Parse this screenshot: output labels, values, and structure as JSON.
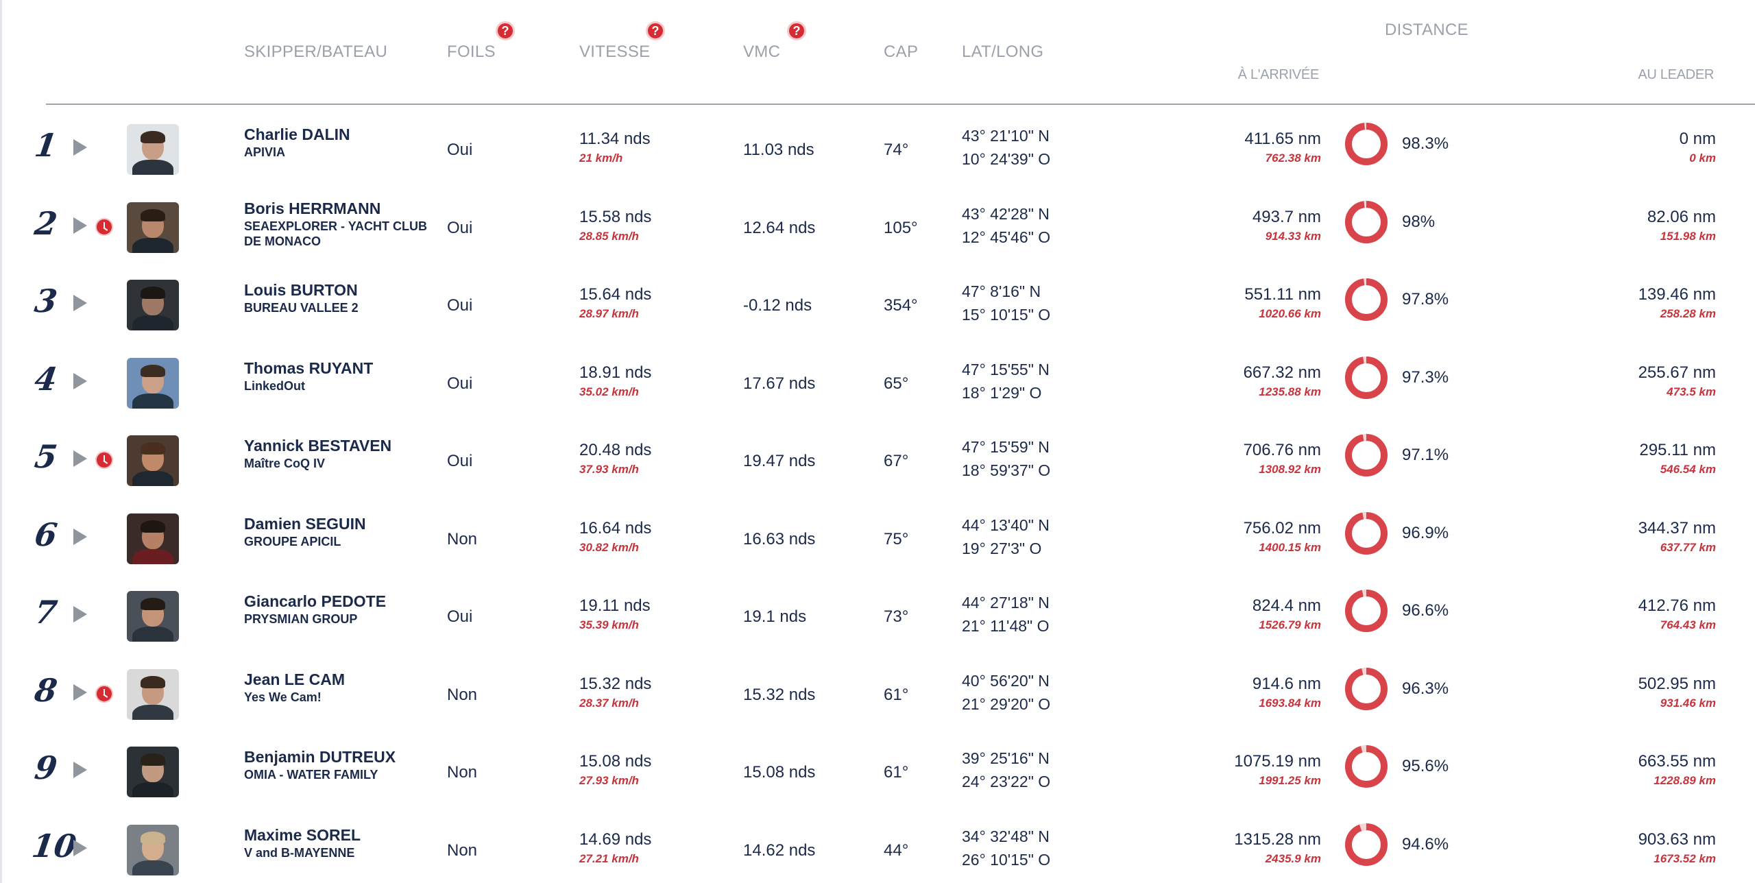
{
  "header": {
    "skipper": "SKIPPER/BATEAU",
    "foils": "FOILS",
    "vitesse": "VITESSE",
    "vmc": "VMC",
    "cap": "CAP",
    "latlong": "LAT/LONG",
    "distance": "DISTANCE",
    "a_arrivee": "À L'ARRIVÉE",
    "au_leader": "AU LEADER",
    "help_glyph": "?"
  },
  "colors": {
    "accent": "#d62b33",
    "text": "#1b2a4a",
    "muted": "#9aa1ab"
  },
  "rows": [
    {
      "rank": "1",
      "clock": false,
      "name": "Charlie DALIN",
      "boat": "APIVIA",
      "foils": "Oui",
      "speed": "11.34 nds",
      "speed_kmh": "21 km/h",
      "vmc": "11.03 nds",
      "cap": "74°",
      "lat": "43° 21'10\" N",
      "lon": "10° 24'39\" O",
      "dist": "411.65 nm",
      "dist_km": "762.38 km",
      "pct": "98.3%",
      "pct_value": 98.3,
      "lead": "0 nm",
      "lead_km": "0 km"
    },
    {
      "rank": "2",
      "clock": true,
      "name": "Boris HERRMANN",
      "boat": "SEAEXPLORER - YACHT CLUB DE MONACO",
      "foils": "Oui",
      "speed": "15.58 nds",
      "speed_kmh": "28.85 km/h",
      "vmc": "12.64 nds",
      "cap": "105°",
      "lat": "43° 42'28\" N",
      "lon": "12° 45'46\" O",
      "dist": "493.7 nm",
      "dist_km": "914.33 km",
      "pct": "98%",
      "pct_value": 98,
      "lead": "82.06 nm",
      "lead_km": "151.98 km"
    },
    {
      "rank": "3",
      "clock": false,
      "name": "Louis BURTON",
      "boat": "BUREAU VALLEE 2",
      "foils": "Oui",
      "speed": "15.64 nds",
      "speed_kmh": "28.97 km/h",
      "vmc": "-0.12 nds",
      "cap": "354°",
      "lat": "47° 8'16\" N",
      "lon": "15° 10'15\" O",
      "dist": "551.11 nm",
      "dist_km": "1020.66 km",
      "pct": "97.8%",
      "pct_value": 97.8,
      "lead": "139.46 nm",
      "lead_km": "258.28 km"
    },
    {
      "rank": "4",
      "clock": false,
      "name": "Thomas RUYANT",
      "boat": "LinkedOut",
      "foils": "Oui",
      "speed": "18.91 nds",
      "speed_kmh": "35.02 km/h",
      "vmc": "17.67 nds",
      "cap": "65°",
      "lat": "47° 15'55\" N",
      "lon": "18° 1'29\" O",
      "dist": "667.32 nm",
      "dist_km": "1235.88 km",
      "pct": "97.3%",
      "pct_value": 97.3,
      "lead": "255.67 nm",
      "lead_km": "473.5 km"
    },
    {
      "rank": "5",
      "clock": true,
      "name": "Yannick BESTAVEN",
      "boat": "Maître CoQ IV",
      "foils": "Oui",
      "speed": "20.48 nds",
      "speed_kmh": "37.93 km/h",
      "vmc": "19.47 nds",
      "cap": "67°",
      "lat": "47° 15'59\" N",
      "lon": "18° 59'37\" O",
      "dist": "706.76 nm",
      "dist_km": "1308.92 km",
      "pct": "97.1%",
      "pct_value": 97.1,
      "lead": "295.11 nm",
      "lead_km": "546.54 km"
    },
    {
      "rank": "6",
      "clock": false,
      "name": "Damien SEGUIN",
      "boat": "GROUPE APICIL",
      "foils": "Non",
      "speed": "16.64 nds",
      "speed_kmh": "30.82 km/h",
      "vmc": "16.63 nds",
      "cap": "75°",
      "lat": "44° 13'40\" N",
      "lon": "19° 27'3\" O",
      "dist": "756.02 nm",
      "dist_km": "1400.15 km",
      "pct": "96.9%",
      "pct_value": 96.9,
      "lead": "344.37 nm",
      "lead_km": "637.77 km"
    },
    {
      "rank": "7",
      "clock": false,
      "name": "Giancarlo PEDOTE",
      "boat": "PRYSMIAN GROUP",
      "foils": "Oui",
      "speed": "19.11 nds",
      "speed_kmh": "35.39 km/h",
      "vmc": "19.1 nds",
      "cap": "73°",
      "lat": "44° 27'18\" N",
      "lon": "21° 11'48\" O",
      "dist": "824.4 nm",
      "dist_km": "1526.79 km",
      "pct": "96.6%",
      "pct_value": 96.6,
      "lead": "412.76 nm",
      "lead_km": "764.43 km"
    },
    {
      "rank": "8",
      "clock": true,
      "name": "Jean LE CAM",
      "boat": "Yes We Cam!",
      "foils": "Non",
      "speed": "15.32 nds",
      "speed_kmh": "28.37 km/h",
      "vmc": "15.32 nds",
      "cap": "61°",
      "lat": "40° 56'20\" N",
      "lon": "21° 29'20\" O",
      "dist": "914.6 nm",
      "dist_km": "1693.84 km",
      "pct": "96.3%",
      "pct_value": 96.3,
      "lead": "502.95 nm",
      "lead_km": "931.46 km"
    },
    {
      "rank": "9",
      "clock": false,
      "name": "Benjamin DUTREUX",
      "boat": "OMIA - WATER FAMILY",
      "foils": "Non",
      "speed": "15.08 nds",
      "speed_kmh": "27.93 km/h",
      "vmc": "15.08 nds",
      "cap": "61°",
      "lat": "39° 25'16\" N",
      "lon": "24° 23'22\" O",
      "dist": "1075.19 nm",
      "dist_km": "1991.25 km",
      "pct": "95.6%",
      "pct_value": 95.6,
      "lead": "663.55 nm",
      "lead_km": "1228.89 km"
    },
    {
      "rank": "10",
      "clock": false,
      "name": "Maxime SOREL",
      "boat": "V and B-MAYENNE",
      "foils": "Non",
      "speed": "14.69 nds",
      "speed_kmh": "27.21 km/h",
      "vmc": "14.62 nds",
      "cap": "44°",
      "lat": "34° 32'48\" N",
      "lon": "26° 10'15\" O",
      "dist": "1315.28 nm",
      "dist_km": "2435.9 km",
      "pct": "94.6%",
      "pct_value": 94.6,
      "lead": "903.63 nm",
      "lead_km": "1673.52 km"
    }
  ]
}
